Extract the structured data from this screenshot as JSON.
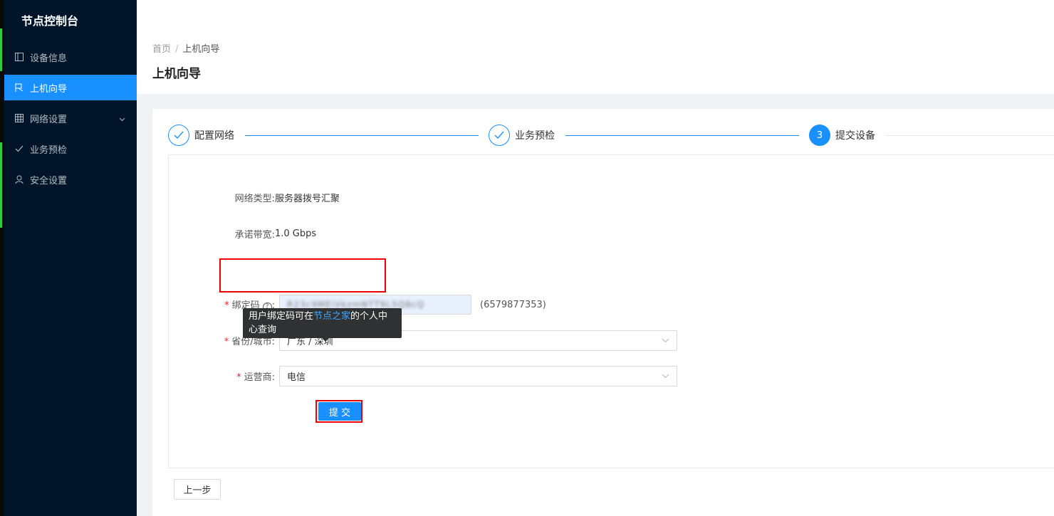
{
  "sidebar": {
    "title": "节点控制台",
    "items": [
      {
        "label": "设备信息",
        "icon": "panel-icon"
      },
      {
        "label": "上机向导",
        "icon": "flag-icon",
        "active": true
      },
      {
        "label": "网络设置",
        "icon": "grid-icon",
        "has_submenu": true
      },
      {
        "label": "业务预检",
        "icon": "check-icon"
      },
      {
        "label": "安全设置",
        "icon": "user-icon"
      }
    ]
  },
  "breadcrumb": {
    "home": "首页",
    "separator": "/",
    "current": "上机向导"
  },
  "page_title": "上机向导",
  "steps": [
    {
      "label": "配置网络",
      "status": "done"
    },
    {
      "label": "业务预检",
      "status": "done"
    },
    {
      "label": "提交设备",
      "status": "current",
      "number": "3"
    }
  ],
  "form": {
    "network_type": {
      "label": "网络类型:",
      "value": "服务器拨号汇聚"
    },
    "bandwidth": {
      "label": "承诺带宽:",
      "value": "1.0 Gbps"
    },
    "bind_code": {
      "label": "绑定码",
      "help": "?",
      "colon": ":",
      "value": "R23c9MEiVkzmNTT9L5Q8cQ",
      "extra": "(6579877353)"
    },
    "province_city": {
      "label": "省份/城市:",
      "value": "广东 / 深圳"
    },
    "operator": {
      "label": "运营商:",
      "value": "电信"
    },
    "required_mark": "*"
  },
  "tooltip": {
    "before": "用户绑定码可在",
    "link": "节点之家",
    "after": "的个人中心查询"
  },
  "buttons": {
    "submit": "提 交",
    "previous": "上一步"
  },
  "colors": {
    "sidebar_bg": "#001529",
    "accent": "#1890ff",
    "highlight": "#e00000"
  }
}
